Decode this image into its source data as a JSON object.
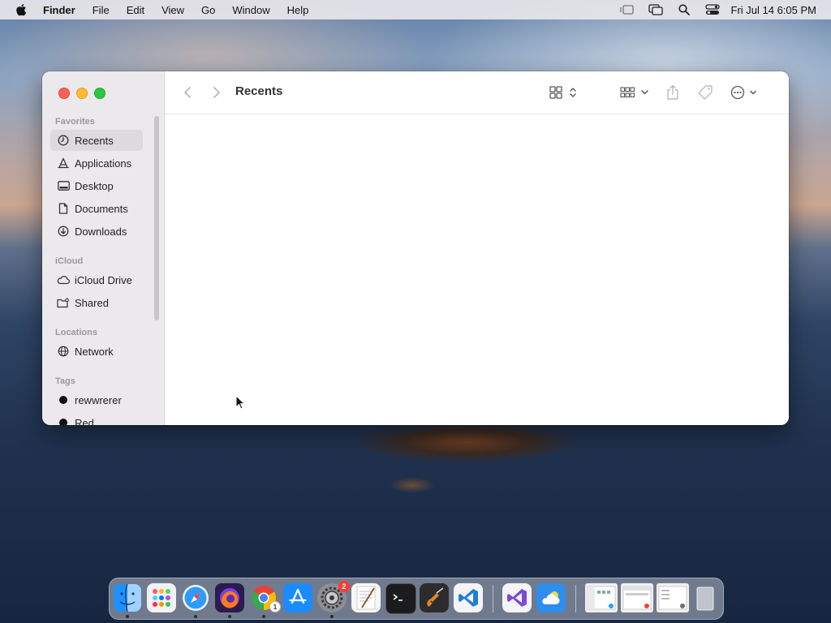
{
  "menubar": {
    "app_name": "Finder",
    "menus": [
      "File",
      "Edit",
      "View",
      "Go",
      "Window",
      "Help"
    ],
    "clock": "Fri Jul 14  6:05 PM",
    "status_icons": [
      "stage-manager-icon",
      "screen-mirroring-icon",
      "spotlight-search-icon",
      "control-center-icon"
    ]
  },
  "window": {
    "title": "Recents",
    "sidebar": {
      "sections": {
        "favorites": "Favorites",
        "icloud": "iCloud",
        "locations": "Locations",
        "tags": "Tags"
      },
      "favorites": [
        {
          "label": "Recents",
          "icon": "clock-icon",
          "selected": true
        },
        {
          "label": "Applications",
          "icon": "applications-icon"
        },
        {
          "label": "Desktop",
          "icon": "desktop-icon"
        },
        {
          "label": "Documents",
          "icon": "document-icon"
        },
        {
          "label": "Downloads",
          "icon": "download-icon"
        }
      ],
      "icloud": [
        {
          "label": "iCloud Drive",
          "icon": "cloud-icon"
        },
        {
          "label": "Shared",
          "icon": "shared-folder-icon"
        }
      ],
      "locations": [
        {
          "label": "Network",
          "icon": "globe-icon"
        }
      ],
      "tags": [
        {
          "label": "rewwrerer",
          "color": "#111111"
        },
        {
          "label": "Red",
          "color": "#111111"
        }
      ]
    },
    "toolbar": {
      "icons": [
        "back-icon",
        "forward-icon",
        "view-mode-icon",
        "group-icon",
        "share-icon",
        "tag-icon",
        "more-actions-icon",
        "search-icon"
      ]
    }
  },
  "dock": {
    "apps": [
      {
        "name": "Finder",
        "running": true
      },
      {
        "name": "Launchpad",
        "running": false
      },
      {
        "name": "Safari",
        "running": true
      },
      {
        "name": "Firefox",
        "running": true
      },
      {
        "name": "Chrome",
        "running": true,
        "sub_badge": "1"
      },
      {
        "name": "App Store",
        "running": false
      },
      {
        "name": "System Settings",
        "running": true,
        "badge": "2"
      },
      {
        "name": "TextEdit",
        "running": false
      },
      {
        "name": "Terminal",
        "running": false
      },
      {
        "name": "Instruments",
        "running": false
      },
      {
        "name": "Visual Studio Code",
        "running": false
      },
      {
        "name": "Visual Studio",
        "running": false
      },
      {
        "name": "Weather",
        "running": false
      }
    ]
  },
  "colors": {
    "close": "#fe5f57",
    "minimize": "#febc2e",
    "maximize": "#28c840",
    "badge": "#ff3b30"
  }
}
